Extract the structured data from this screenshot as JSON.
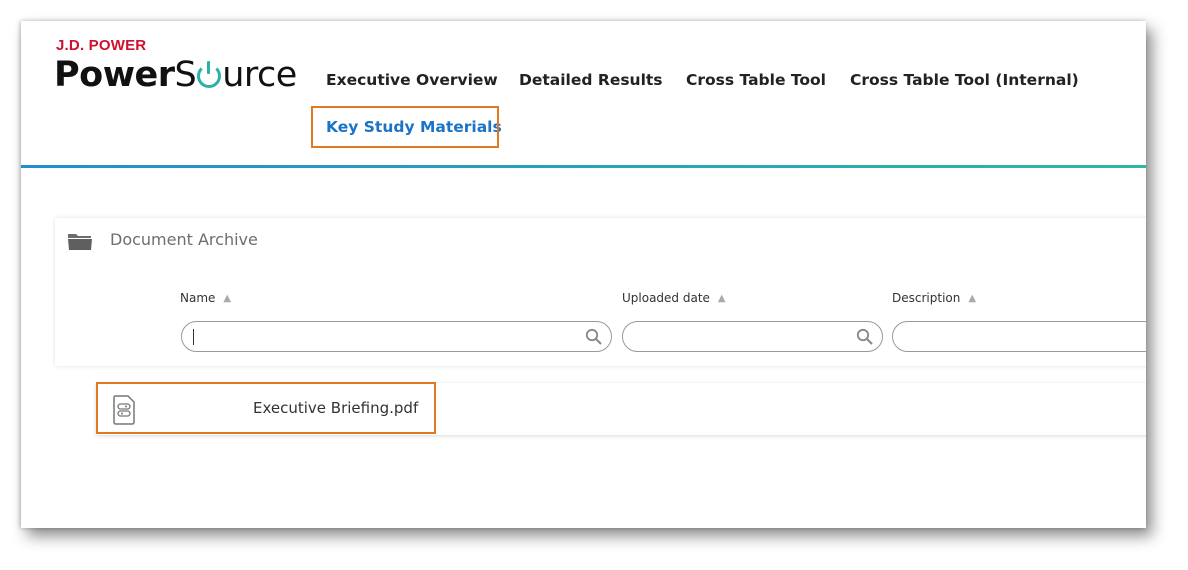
{
  "header": {
    "brand_top": "J.D. POWER",
    "brand_part1": "Power",
    "brand_part2": "S",
    "brand_part3": "urce",
    "nav": [
      {
        "label": "Executive Overview"
      },
      {
        "label": "Detailed Results"
      },
      {
        "label": "Cross Table Tool"
      },
      {
        "label": "Cross Table Tool (Internal)"
      },
      {
        "label": "Key Study Materials",
        "active": true
      }
    ]
  },
  "archive": {
    "title": "Document Archive",
    "columns": [
      {
        "label": "Name",
        "filter_value": ""
      },
      {
        "label": "Uploaded date",
        "filter_value": ""
      },
      {
        "label": "Description",
        "filter_value": ""
      }
    ],
    "files": [
      {
        "name": "Executive Briefing.pdf",
        "icon": "document-icon"
      }
    ]
  },
  "colors": {
    "brand_red": "#d0102f",
    "accent_teal": "#2bb2a8",
    "active_link": "#1a73c9",
    "highlight_orange": "#e07a22"
  }
}
